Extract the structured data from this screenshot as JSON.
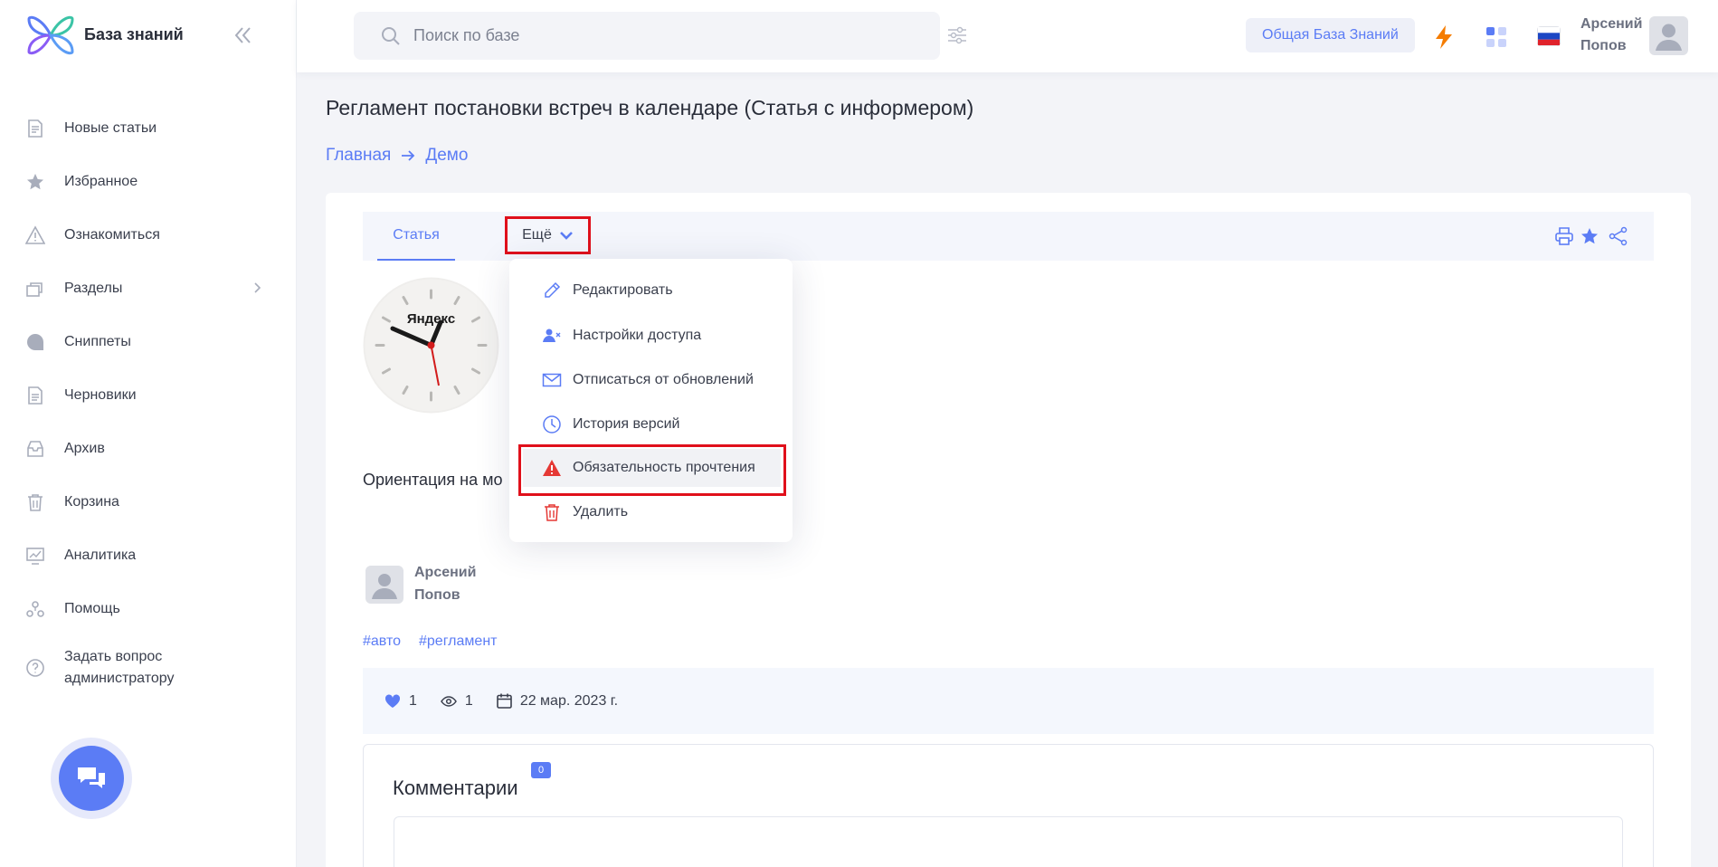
{
  "app": {
    "name": "База знаний"
  },
  "sidebar": {
    "items": [
      {
        "label": "Новые статьи",
        "icon": "new-articles-icon"
      },
      {
        "label": "Избранное",
        "icon": "star-icon"
      },
      {
        "label": "Ознакомиться",
        "icon": "warning-icon"
      },
      {
        "label": "Разделы",
        "icon": "sections-icon"
      },
      {
        "label": "Сниппеты",
        "icon": "snippets-icon"
      },
      {
        "label": "Черновики",
        "icon": "drafts-icon"
      },
      {
        "label": "Архив",
        "icon": "archive-icon"
      },
      {
        "label": "Корзина",
        "icon": "trash-icon"
      },
      {
        "label": "Аналитика",
        "icon": "analytics-icon"
      },
      {
        "label": "Помощь",
        "icon": "help-icon"
      },
      {
        "label_line1": "Задать вопрос",
        "label_line2": "администратору",
        "icon": "question-icon"
      }
    ]
  },
  "header": {
    "search_placeholder": "Поиск по базе",
    "kb_button": "Общая База Знаний",
    "user_first": "Арсений",
    "user_last": "Попов"
  },
  "page": {
    "title": "Регламент постановки встреч в календаре (Статья с информером)",
    "breadcrumb": [
      "Главная",
      "Демо"
    ]
  },
  "tabs": {
    "article": "Статья",
    "more": "Ещё"
  },
  "dropdown": {
    "items": [
      {
        "label": "Редактировать",
        "icon": "pencil-icon"
      },
      {
        "label": "Настройки доступа",
        "icon": "user-access-icon"
      },
      {
        "label": "Отписаться от обновлений",
        "icon": "envelope-icon"
      },
      {
        "label": "История версий",
        "icon": "history-icon"
      },
      {
        "label": "Обязательность прочтения",
        "icon": "alert-triangle-icon"
      },
      {
        "label": "Удалить",
        "icon": "trash-icon"
      }
    ]
  },
  "article": {
    "clock_brand": "Яндекс",
    "text": "Ориентация на мо",
    "author_first": "Арсений",
    "author_last": "Попов",
    "tags": [
      "#авто",
      "#регламент"
    ],
    "likes": "1",
    "views": "1",
    "date": "22 мар. 2023 г."
  },
  "comments": {
    "title": "Комментарии",
    "count": "0"
  },
  "colors": {
    "accent": "#5b7cf5",
    "highlight": "#e0101b",
    "bolt": "#f57c00"
  }
}
